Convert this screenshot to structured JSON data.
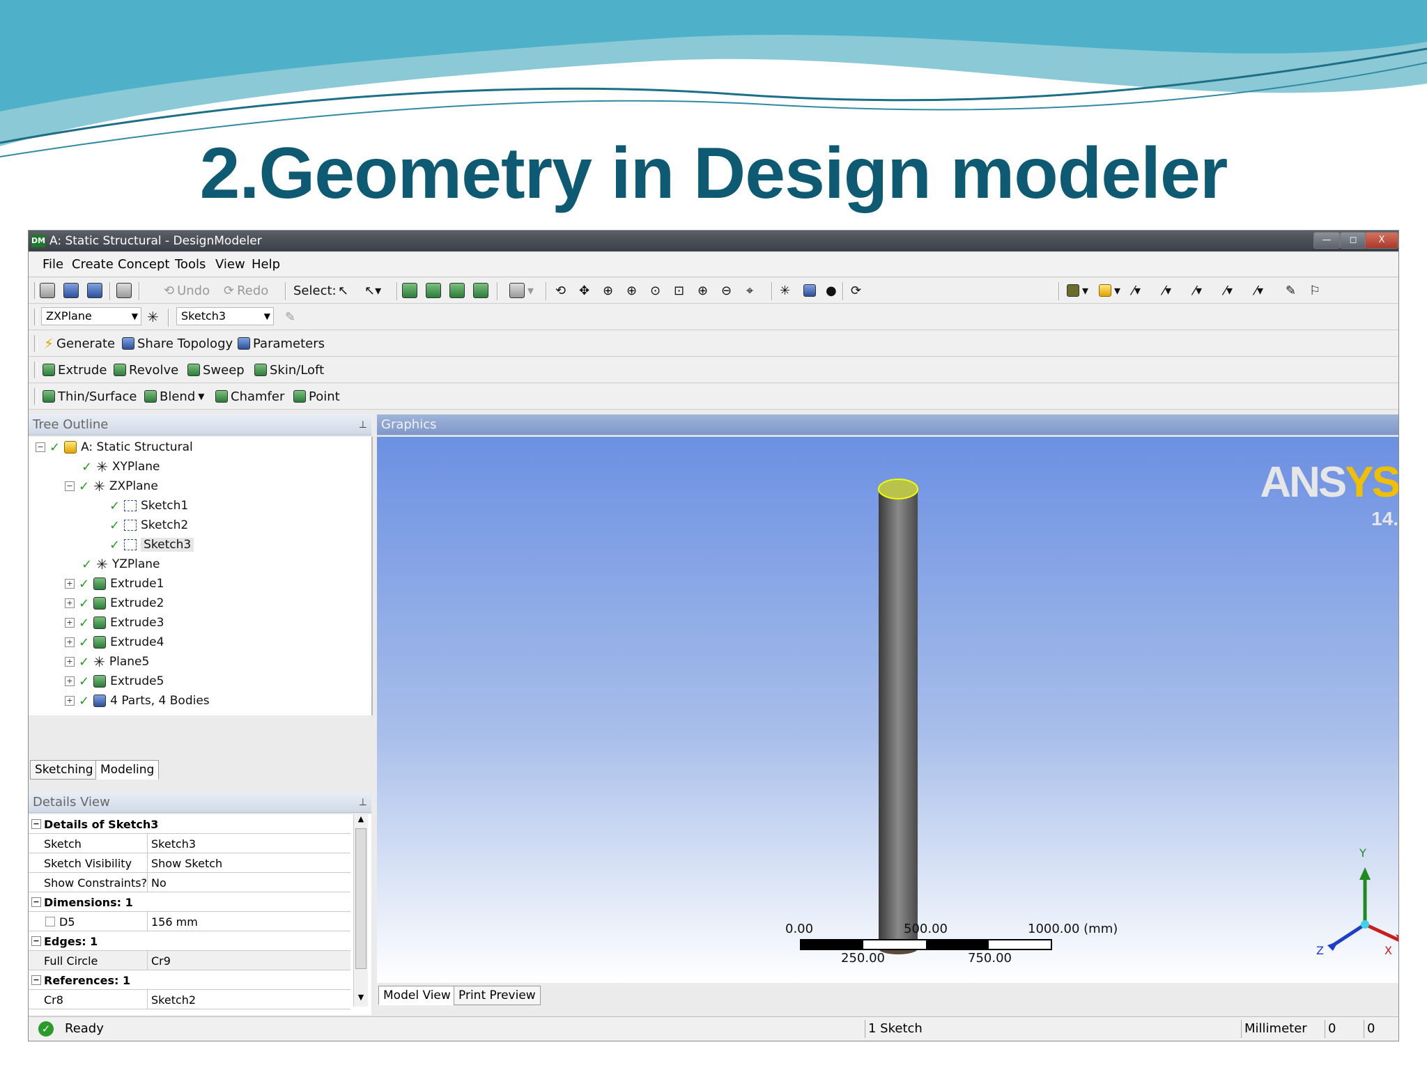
{
  "slide": {
    "title": "2.Geometry in Design modeler"
  },
  "window": {
    "title": "A: Static Structural - DesignModeler",
    "app_icon": "DM",
    "close_glyph": "X"
  },
  "menu": [
    "File",
    "Create",
    "Concept",
    "Tools",
    "View",
    "Help"
  ],
  "toolbar1": {
    "undo": "Undo",
    "redo": "Redo",
    "select_label": "Select:"
  },
  "toolbar2": {
    "plane": "ZXPlane",
    "sketch": "Sketch3"
  },
  "toolbar3": {
    "generate": "Generate",
    "share_topology": "Share Topology",
    "parameters": "Parameters"
  },
  "toolbar4": {
    "extrude": "Extrude",
    "revolve": "Revolve",
    "sweep": "Sweep",
    "skin_loft": "Skin/Loft"
  },
  "toolbar5": {
    "thin_surface": "Thin/Surface",
    "blend": "Blend",
    "chamfer": "Chamfer",
    "point": "Point"
  },
  "tree_outline": {
    "header": "Tree Outline",
    "items": [
      {
        "label": "A: Static Structural"
      },
      {
        "label": "XYPlane"
      },
      {
        "label": "ZXPlane"
      },
      {
        "label": "Sketch1"
      },
      {
        "label": "Sketch2"
      },
      {
        "label": "Sketch3"
      },
      {
        "label": "YZPlane"
      },
      {
        "label": "Extrude1"
      },
      {
        "label": "Extrude2"
      },
      {
        "label": "Extrude3"
      },
      {
        "label": "Extrude4"
      },
      {
        "label": "Plane5"
      },
      {
        "label": "Extrude5"
      },
      {
        "label": "4 Parts, 4 Bodies"
      }
    ],
    "tabs": [
      "Sketching",
      "Modeling"
    ]
  },
  "details_view": {
    "header": "Details View",
    "rows": [
      {
        "kind": "group",
        "label": "Details of Sketch3"
      },
      {
        "kind": "row",
        "label": "Sketch",
        "value": "Sketch3"
      },
      {
        "kind": "row",
        "label": "Sketch Visibility",
        "value": "Show Sketch"
      },
      {
        "kind": "row",
        "label": "Show Constraints?",
        "value": "No"
      },
      {
        "kind": "group",
        "label": "Dimensions: 1"
      },
      {
        "kind": "row",
        "label": "D5",
        "value": "156 mm"
      },
      {
        "kind": "group",
        "label": "Edges: 1"
      },
      {
        "kind": "row",
        "label": "Full Circle",
        "value": "Cr9"
      },
      {
        "kind": "group",
        "label": "References: 1"
      },
      {
        "kind": "row",
        "label": "Cr8",
        "value": "Sketch2"
      }
    ]
  },
  "graphics": {
    "header": "Graphics",
    "logo_main": "ANS",
    "logo_accent": "YS",
    "logo_version": "14.",
    "scale": {
      "top_labels": [
        "0.00",
        "500.00",
        "1000.00 (mm)"
      ],
      "bottom_labels": [
        "250.00",
        "750.00"
      ]
    },
    "axes": {
      "y": "Y",
      "x": "X",
      "z": "Z"
    },
    "tabs": [
      "Model View",
      "Print Preview"
    ]
  },
  "status": {
    "ready": "Ready",
    "sketch_count": "1 Sketch",
    "units": "Millimeter",
    "coord1": "0",
    "coord2": "0"
  },
  "colors": {
    "title": "#0e5a72",
    "graphics_top": "#6c90e2",
    "accent_yellow": "#f0c000"
  }
}
